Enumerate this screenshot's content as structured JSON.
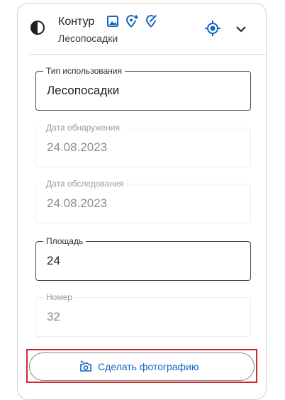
{
  "header": {
    "title": "Контур",
    "subtitle": "Лесопосадки"
  },
  "icons": {
    "contrast": "contrast-icon",
    "image": "image-icon",
    "add_location": "add-location-icon",
    "edit_location": "edit-location-icon",
    "locate": "my-location-icon",
    "chevron": "chevron-down-icon",
    "camera": "add-camera-icon"
  },
  "colors": {
    "accent": "#1565c0",
    "highlight": "#d0262c"
  },
  "fields": {
    "usage_type": {
      "label": "Тип использования",
      "value": "Лесопосадки"
    },
    "detection_date": {
      "label": "Дата обнаружения",
      "value": "24.08.2023"
    },
    "survey_date": {
      "label": "Дата обследования",
      "value": "24.08.2023"
    },
    "area": {
      "label": "Площадь",
      "value": "24"
    },
    "number": {
      "label": "Номер",
      "value": "32"
    }
  },
  "photo_button": {
    "label": "Сделать фотографию"
  }
}
